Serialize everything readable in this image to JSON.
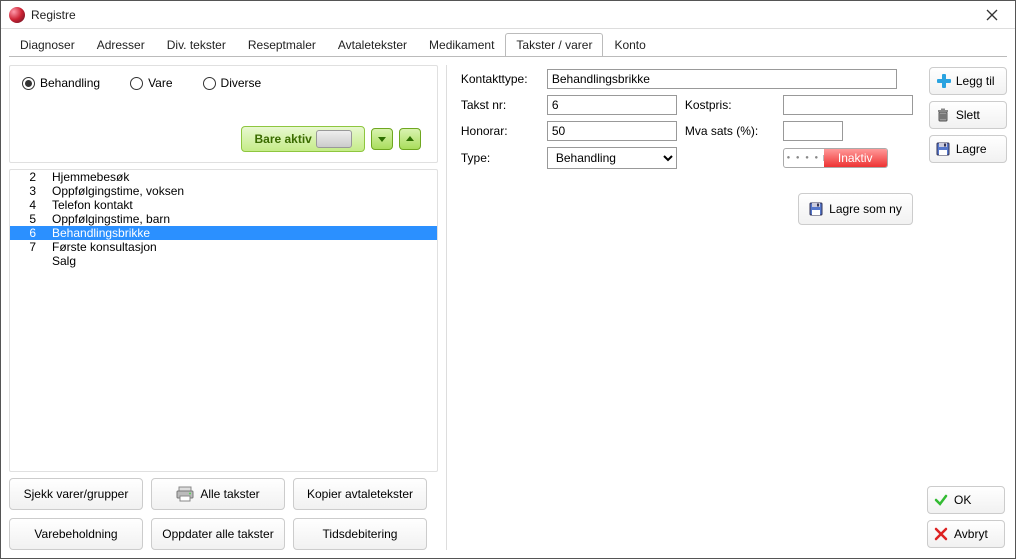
{
  "window_title": "Registre",
  "tabs": [
    "Diagnoser",
    "Adresser",
    "Div. tekster",
    "Reseptmaler",
    "Avtaletekster",
    "Medikament",
    "Takster / varer",
    "Konto"
  ],
  "active_tab": 6,
  "radios": {
    "behandling": "Behandling",
    "vare": "Vare",
    "diverse": "Diverse"
  },
  "toolbar": {
    "bare_aktiv": "Bare aktiv"
  },
  "list": [
    {
      "num": "2",
      "label": "Hjemmebesøk"
    },
    {
      "num": "3",
      "label": "Oppfølgingstime, voksen"
    },
    {
      "num": "4",
      "label": "Telefon kontakt"
    },
    {
      "num": "5",
      "label": "Oppfølgingstime, barn"
    },
    {
      "num": "6",
      "label": "Behandlingsbrikke"
    },
    {
      "num": "7",
      "label": "Første konsultasjon"
    },
    {
      "num": "",
      "label": "Salg"
    }
  ],
  "selected_index": 4,
  "bottom_buttons": {
    "sjekk": "Sjekk varer/grupper",
    "alle": "Alle takster",
    "kopier": "Kopier avtaletekster",
    "varebeh": "Varebeholdning",
    "oppdater": "Oppdater alle takster",
    "tids": "Tidsdebitering"
  },
  "fields": {
    "kontakttype_lbl": "Kontakttype:",
    "kontakttype_val": "Behandlingsbrikke",
    "takstnr_lbl": "Takst nr:",
    "takstnr_val": "6",
    "kostpris_lbl": "Kostpris:",
    "kostpris_val": "",
    "honorar_lbl": "Honorar:",
    "honorar_val": "50",
    "mva_lbl": "Mva sats (%):",
    "mva_val": "",
    "type_lbl": "Type:",
    "type_val": "Behandling",
    "inaktiv": "Inaktiv",
    "lagre_som_ny": "Lagre som ny"
  },
  "side": {
    "legg_til": "Legg til",
    "slett": "Slett",
    "lagre": "Lagre"
  },
  "footer": {
    "ok": "OK",
    "avbryt": "Avbryt"
  }
}
